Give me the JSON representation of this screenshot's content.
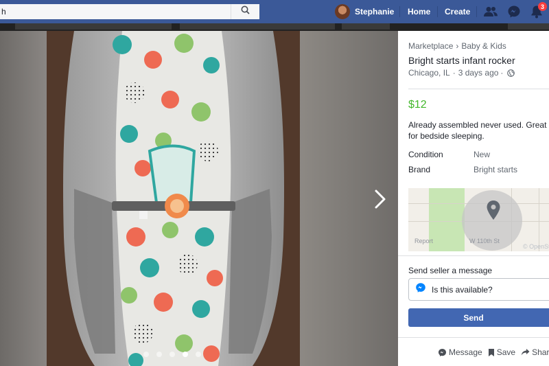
{
  "topbar": {
    "search_value": "h",
    "profile_name": "Stephanie",
    "home_label": "Home",
    "create_label": "Create",
    "notifications_count": "3"
  },
  "viewer": {
    "photo_count": 5,
    "active_photo": 4
  },
  "listing": {
    "breadcrumb": [
      "Marketplace",
      "Baby & Kids"
    ],
    "breadcrumb_separator": "›",
    "title": "Bright starts infant rocker",
    "location": "Chicago, IL",
    "posted": "3 days ago",
    "meta_separator": "·",
    "price": "$12",
    "description": "Already assembled never used. Great for bedside sleeping.",
    "details": [
      {
        "label": "Condition",
        "value": "New"
      },
      {
        "label": "Brand",
        "value": "Bright starts"
      }
    ]
  },
  "map": {
    "report_label": "Report",
    "street_label": "W 110th St",
    "attribution": "© OpenStreetMap"
  },
  "message": {
    "label": "Send seller a message",
    "input_value": "Is this available?",
    "send_label": "Send"
  },
  "actions": {
    "message_label": "Message",
    "save_label": "Save",
    "share_label": "Share"
  },
  "colors": {
    "topbar": "#3b5998",
    "price": "#42b72a",
    "send_button": "#4267b2"
  }
}
